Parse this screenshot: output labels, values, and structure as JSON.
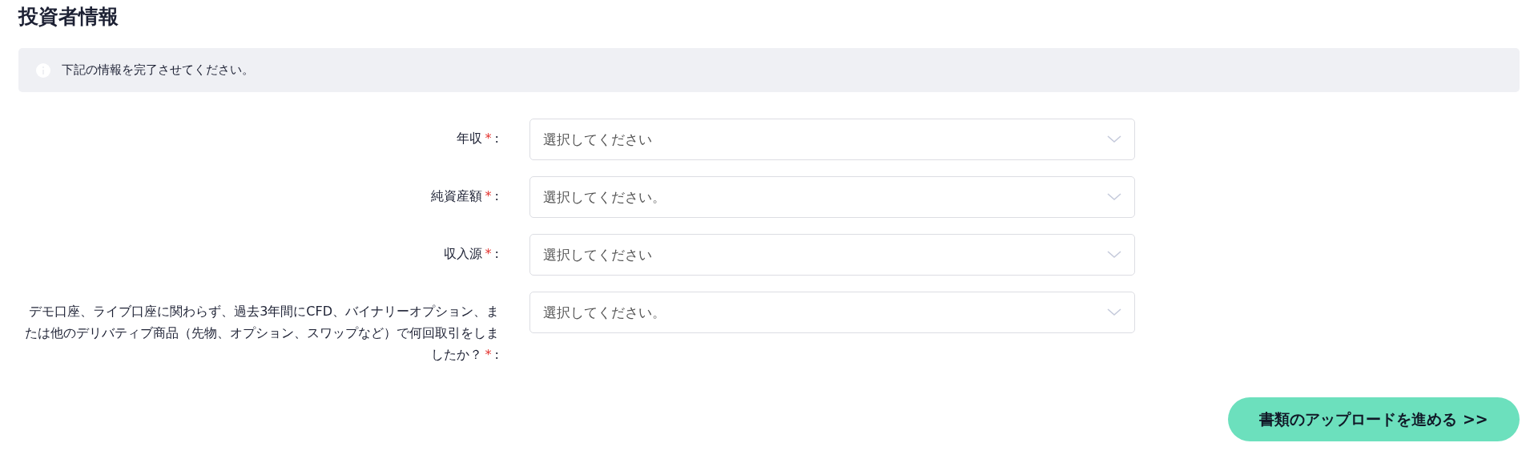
{
  "title": "投資者情報",
  "notice": {
    "text": "下記の情報を完了させてください。"
  },
  "fields": [
    {
      "label": "年収",
      "required_mark": "*",
      "suffix": ":",
      "placeholder": "選択してください"
    },
    {
      "label": "純資産額",
      "required_mark": "*",
      "suffix": ":",
      "placeholder": "選択してください。"
    },
    {
      "label": "収入源",
      "required_mark": "*",
      "suffix": ":",
      "placeholder": "選択してください"
    },
    {
      "label": "デモ口座、ライブ口座に関わらず、過去3年間にCFD、バイナリーオプション、または他のデリバティブ商品（先物、オプション、スワップなど）で何回取引をしましたか？",
      "required_mark": "*",
      "suffix": ":",
      "placeholder": "選択してください。"
    }
  ],
  "next_button": "書類のアップロードを進める >>"
}
